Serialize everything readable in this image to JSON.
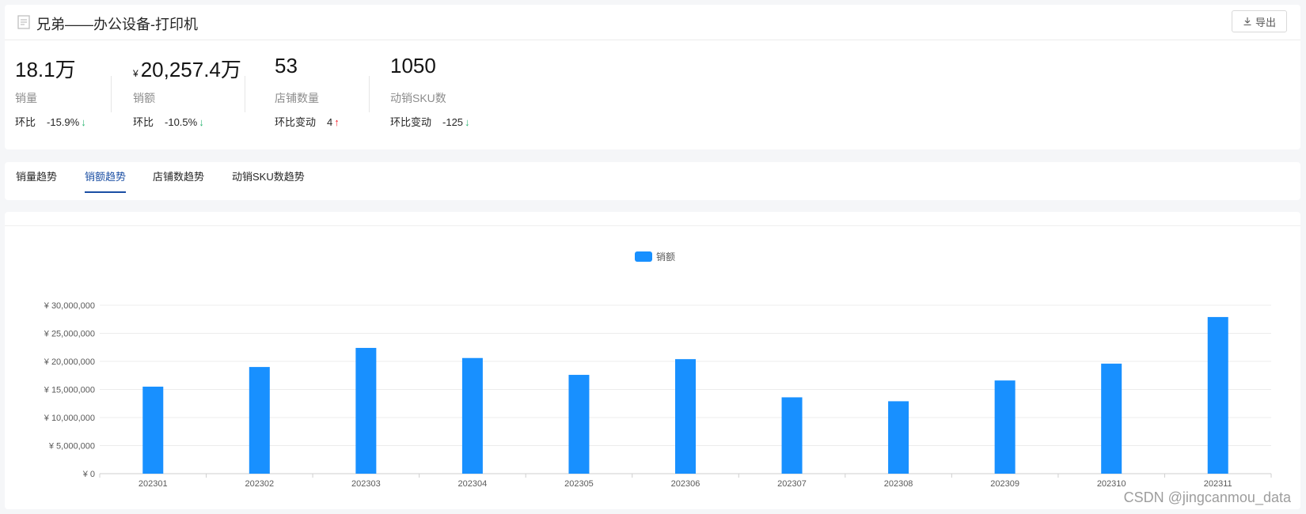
{
  "header": {
    "title": "兄弟——办公设备-打印机",
    "export_label": "导出"
  },
  "kpis": [
    {
      "value": "18.1万",
      "currency": "",
      "label": "销量",
      "change_label": "环比",
      "change": "-15.9%",
      "direction": "down"
    },
    {
      "value": "20,257.4万",
      "currency": "¥",
      "label": "销额",
      "change_label": "环比",
      "change": "-10.5%",
      "direction": "down"
    },
    {
      "value": "53",
      "currency": "",
      "label": "店铺数量",
      "change_label": "环比变动",
      "change": "4",
      "direction": "up"
    },
    {
      "value": "1050",
      "currency": "",
      "label": "动销SKU数",
      "change_label": "环比变动",
      "change": "-125",
      "direction": "down"
    }
  ],
  "tabs": [
    {
      "label": "销量趋势",
      "active": false
    },
    {
      "label": "销额趋势",
      "active": true
    },
    {
      "label": "店铺数趋势",
      "active": false
    },
    {
      "label": "动销SKU数趋势",
      "active": false
    }
  ],
  "arrows": {
    "down": "↓",
    "up": "↑"
  },
  "watermark": "CSDN @jingcanmou_data",
  "colors": {
    "bar": "#1890ff",
    "active_tab": "#1a4ea3",
    "up": "#f5222d",
    "down": "#2bb673"
  },
  "chart_data": {
    "type": "bar",
    "legend": [
      "销额"
    ],
    "legend_position": "top-center",
    "categories": [
      "202301",
      "202302",
      "202303",
      "202304",
      "202305",
      "202306",
      "202307",
      "202308",
      "202309",
      "202310",
      "202311"
    ],
    "series": [
      {
        "name": "销额",
        "values": [
          15500000,
          19000000,
          22400000,
          20600000,
          17600000,
          20400000,
          13600000,
          12900000,
          16600000,
          19600000,
          27900000
        ]
      }
    ],
    "ylim": [
      0,
      30000000
    ],
    "yticks": [
      0,
      5000000,
      10000000,
      15000000,
      20000000,
      25000000,
      30000000
    ],
    "ytick_labels": [
      "¥ 0",
      "¥ 5,000,000",
      "¥ 10,000,000",
      "¥ 15,000,000",
      "¥ 20,000,000",
      "¥ 25,000,000",
      "¥ 30,000,000"
    ],
    "grid": true
  }
}
